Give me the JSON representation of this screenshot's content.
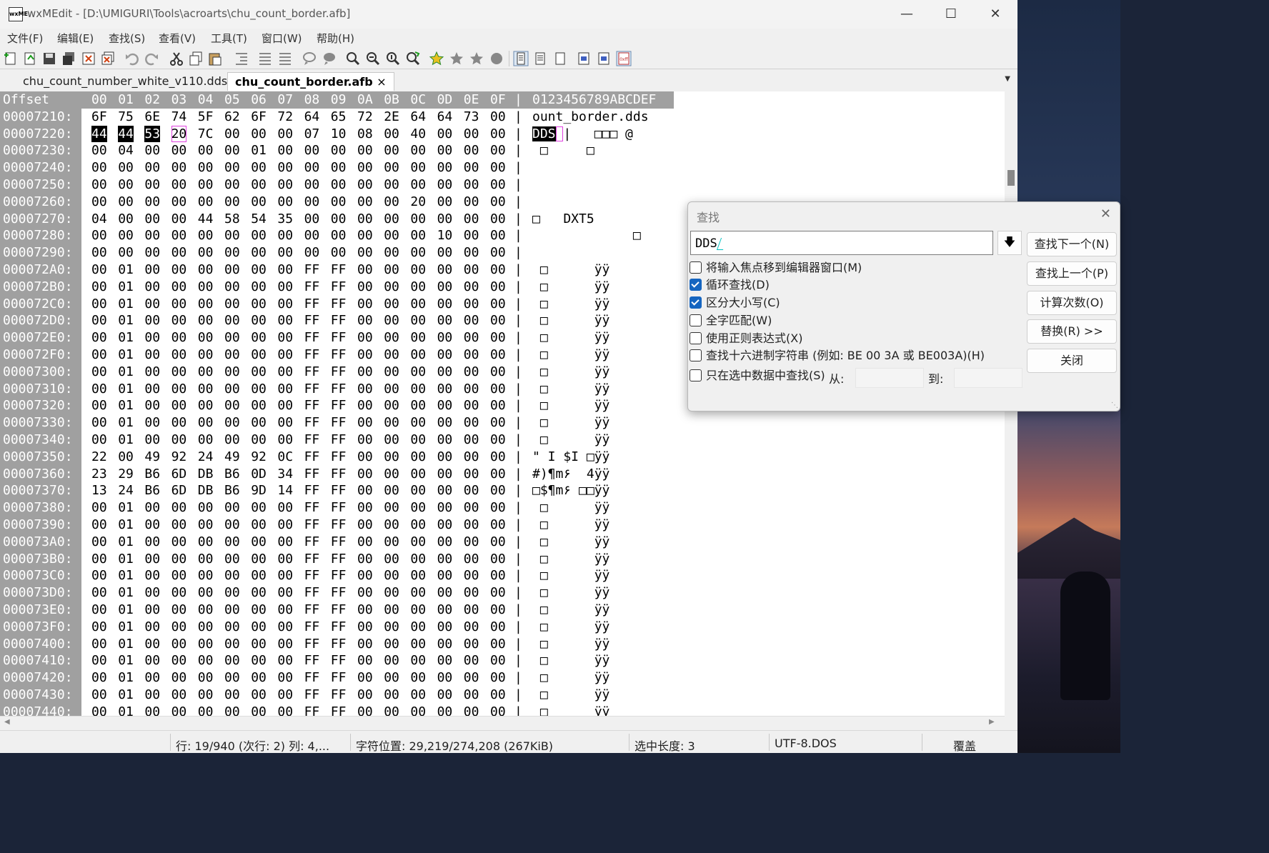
{
  "window": {
    "title": "wxMEdit - [D:\\UMIGURI\\Tools\\acroarts\\chu_count_border.afb]",
    "icon_text": "wxME"
  },
  "menu": [
    "文件(F)",
    "编辑(E)",
    "查找(S)",
    "查看(V)",
    "工具(T)",
    "窗口(W)",
    "帮助(H)"
  ],
  "tabs": [
    {
      "label": "chu_count_number_white_v110.dds",
      "active": false
    },
    {
      "label": "chu_count_border.afb",
      "active": true,
      "close": "×"
    }
  ],
  "editor": {
    "header": {
      "offset": "Offset",
      "cols": [
        "00",
        "01",
        "02",
        "03",
        "04",
        "05",
        "06",
        "07",
        "08",
        "09",
        "0A",
        "0B",
        "0C",
        "0D",
        "0E",
        "0F"
      ],
      "ascii": "0123456789ABCDEF"
    },
    "rows": [
      {
        "off": "00007210:",
        "hex": "6F 75 6E 74 5F 62 6F 72 64 65 72 2E 64 64 73 00",
        "asc": "ount_border.dds"
      },
      {
        "off": "00007220:",
        "hex": "44 44 53 20 7C 00 00 00 07 10 08 00 40 00 00 00",
        "asc": "DDS |   □□□ @"
      },
      {
        "off": "00007230:",
        "hex": "00 04 00 00 00 00 01 00 00 00 00 00 00 00 00 00",
        "asc": " □     □"
      },
      {
        "off": "00007240:",
        "hex": "00 00 00 00 00 00 00 00 00 00 00 00 00 00 00 00",
        "asc": ""
      },
      {
        "off": "00007250:",
        "hex": "00 00 00 00 00 00 00 00 00 00 00 00 00 00 00 00",
        "asc": ""
      },
      {
        "off": "00007260:",
        "hex": "00 00 00 00 00 00 00 00 00 00 00 00 20 00 00 00",
        "asc": ""
      },
      {
        "off": "00007270:",
        "hex": "04 00 00 00 44 58 54 35 00 00 00 00 00 00 00 00",
        "asc": "□   DXT5"
      },
      {
        "off": "00007280:",
        "hex": "00 00 00 00 00 00 00 00 00 00 00 00 00 10 00 00",
        "asc": "             □"
      },
      {
        "off": "00007290:",
        "hex": "00 00 00 00 00 00 00 00 00 00 00 00 00 00 00 00",
        "asc": ""
      },
      {
        "off": "000072A0:",
        "hex": "00 01 00 00 00 00 00 00 FF FF 00 00 00 00 00 00",
        "asc": " □      ÿÿ"
      },
      {
        "off": "000072B0:",
        "hex": "00 01 00 00 00 00 00 00 FF FF 00 00 00 00 00 00",
        "asc": " □      ÿÿ"
      },
      {
        "off": "000072C0:",
        "hex": "00 01 00 00 00 00 00 00 FF FF 00 00 00 00 00 00",
        "asc": " □      ÿÿ"
      },
      {
        "off": "000072D0:",
        "hex": "00 01 00 00 00 00 00 00 FF FF 00 00 00 00 00 00",
        "asc": " □      ÿÿ"
      },
      {
        "off": "000072E0:",
        "hex": "00 01 00 00 00 00 00 00 FF FF 00 00 00 00 00 00",
        "asc": " □      ÿÿ"
      },
      {
        "off": "000072F0:",
        "hex": "00 01 00 00 00 00 00 00 FF FF 00 00 00 00 00 00",
        "asc": " □      ÿÿ"
      },
      {
        "off": "00007300:",
        "hex": "00 01 00 00 00 00 00 00 FF FF 00 00 00 00 00 00",
        "asc": " □      ÿÿ"
      },
      {
        "off": "00007310:",
        "hex": "00 01 00 00 00 00 00 00 FF FF 00 00 00 00 00 00",
        "asc": " □      ÿÿ"
      },
      {
        "off": "00007320:",
        "hex": "00 01 00 00 00 00 00 00 FF FF 00 00 00 00 00 00",
        "asc": " □      ÿÿ"
      },
      {
        "off": "00007330:",
        "hex": "00 01 00 00 00 00 00 00 FF FF 00 00 00 00 00 00",
        "asc": " □      ÿÿ"
      },
      {
        "off": "00007340:",
        "hex": "00 01 00 00 00 00 00 00 FF FF 00 00 00 00 00 00",
        "asc": " □      ÿÿ"
      },
      {
        "off": "00007350:",
        "hex": "22 00 49 92 24 49 92 0C FF FF 00 00 00 00 00 00",
        "asc": "\" I $I □ÿÿ"
      },
      {
        "off": "00007360:",
        "hex": "23 29 B6 6D DB B6 0D 34 FF FF 00 00 00 00 00 00",
        "asc": "#)¶m۶  4ÿÿ"
      },
      {
        "off": "00007370:",
        "hex": "13 24 B6 6D DB B6 9D 14 FF FF 00 00 00 00 00 00",
        "asc": "□$¶m۶ □□ÿÿ"
      },
      {
        "off": "00007380:",
        "hex": "00 01 00 00 00 00 00 00 FF FF 00 00 00 00 00 00",
        "asc": " □      ÿÿ"
      },
      {
        "off": "00007390:",
        "hex": "00 01 00 00 00 00 00 00 FF FF 00 00 00 00 00 00",
        "asc": " □      ÿÿ"
      },
      {
        "off": "000073A0:",
        "hex": "00 01 00 00 00 00 00 00 FF FF 00 00 00 00 00 00",
        "asc": " □      ÿÿ"
      },
      {
        "off": "000073B0:",
        "hex": "00 01 00 00 00 00 00 00 FF FF 00 00 00 00 00 00",
        "asc": " □      ÿÿ"
      },
      {
        "off": "000073C0:",
        "hex": "00 01 00 00 00 00 00 00 FF FF 00 00 00 00 00 00",
        "asc": " □      ÿÿ"
      },
      {
        "off": "000073D0:",
        "hex": "00 01 00 00 00 00 00 00 FF FF 00 00 00 00 00 00",
        "asc": " □      ÿÿ"
      },
      {
        "off": "000073E0:",
        "hex": "00 01 00 00 00 00 00 00 FF FF 00 00 00 00 00 00",
        "asc": " □      ÿÿ"
      },
      {
        "off": "000073F0:",
        "hex": "00 01 00 00 00 00 00 00 FF FF 00 00 00 00 00 00",
        "asc": " □      ÿÿ"
      },
      {
        "off": "00007400:",
        "hex": "00 01 00 00 00 00 00 00 FF FF 00 00 00 00 00 00",
        "asc": " □      ÿÿ"
      },
      {
        "off": "00007410:",
        "hex": "00 01 00 00 00 00 00 00 FF FF 00 00 00 00 00 00",
        "asc": " □      ÿÿ"
      },
      {
        "off": "00007420:",
        "hex": "00 01 00 00 00 00 00 00 FF FF 00 00 00 00 00 00",
        "asc": " □      ÿÿ"
      },
      {
        "off": "00007430:",
        "hex": "00 01 00 00 00 00 00 00 FF FF 00 00 00 00 00 00",
        "asc": " □      ÿÿ"
      },
      {
        "off": "00007440:",
        "hex": "00 01 00 00 00 00 00 00 FF FF 00 00 00 00 00 00",
        "asc": " □      ÿÿ"
      }
    ]
  },
  "find_dialog": {
    "title": "查找",
    "input_value": "DDS",
    "history_icon": "arrow-down-icon",
    "options": [
      {
        "label": "将输入焦点移到编辑器窗口(M)",
        "checked": false
      },
      {
        "label": "循环查找(D)",
        "checked": true
      },
      {
        "label": "区分大小写(C)",
        "checked": true
      },
      {
        "label": "全字匹配(W)",
        "checked": false
      },
      {
        "label": "使用正则表达式(X)",
        "checked": false
      },
      {
        "label": "查找十六进制字符串 (例如: BE 00 3A 或 BE003A)(H)",
        "checked": false
      },
      {
        "label": "只在选中数据中查找(S)",
        "checked": false
      }
    ],
    "from_label": "从:",
    "to_label": "到:",
    "buttons": [
      "查找下一个(N)",
      "查找上一个(P)",
      "计算次数(O)",
      "替换(R) >>",
      "关闭"
    ]
  },
  "status": {
    "line": "行: 19/940 (次行: 2)  列: 4,...",
    "char_pos": "字符位置: 29,219/274,208 (267KiB)",
    "sel_len": "选中长度: 3",
    "encoding": "UTF-8.DOS",
    "mode": "覆盖"
  },
  "colors": {
    "gutter": "#a0a0a0",
    "selection": "#000000",
    "match_box": "#e040e0"
  }
}
